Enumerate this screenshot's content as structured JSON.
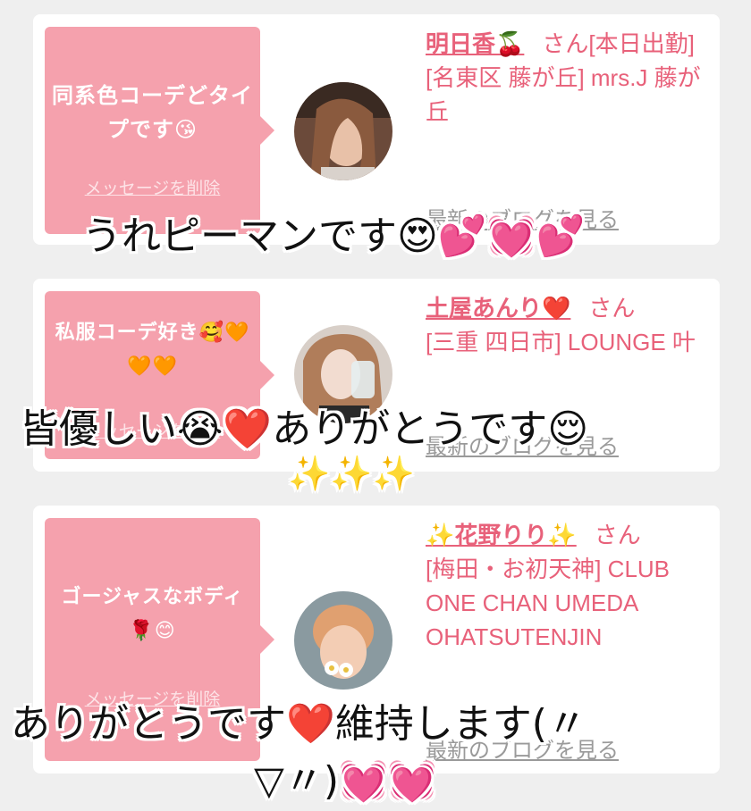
{
  "cards": [
    {
      "message": "同系色コーデどタイプです😘",
      "delete_label": "メッセージを削除",
      "name": "明日香🍒",
      "honorific": "さん",
      "status": "[本日出勤]",
      "shop": "[名東区 藤が丘] mrs.J 藤が丘",
      "blog_label": "最新のブログを見る"
    },
    {
      "message": "私服コーデ好き🥰🧡🧡🧡",
      "delete_label": "メッセージを削除",
      "name": "土屋あんり❤️",
      "honorific": "さん",
      "shop": "[三重 四日市] LOUNGE 叶",
      "blog_label": "最新のブログを見る"
    },
    {
      "message": "ゴージャスなボディ🌹😊",
      "delete_label": "メッセージを削除",
      "name": "✨花野りり✨",
      "honorific": "さん",
      "shop": "[梅田・お初天神] CLUB ONE CHAN UMEDA OHATSUTENJIN",
      "blog_label": "最新のブログを見る"
    }
  ],
  "captions": {
    "c1": "うれピーマンです😍💕💓💕",
    "c2_line1": "皆優しい😭❤️ありがとうです😌",
    "c2_line2": "✨✨✨",
    "c3_line1": "ありがとうです❤️維持します(〃",
    "c3_line2": "▽〃)💓💓"
  }
}
